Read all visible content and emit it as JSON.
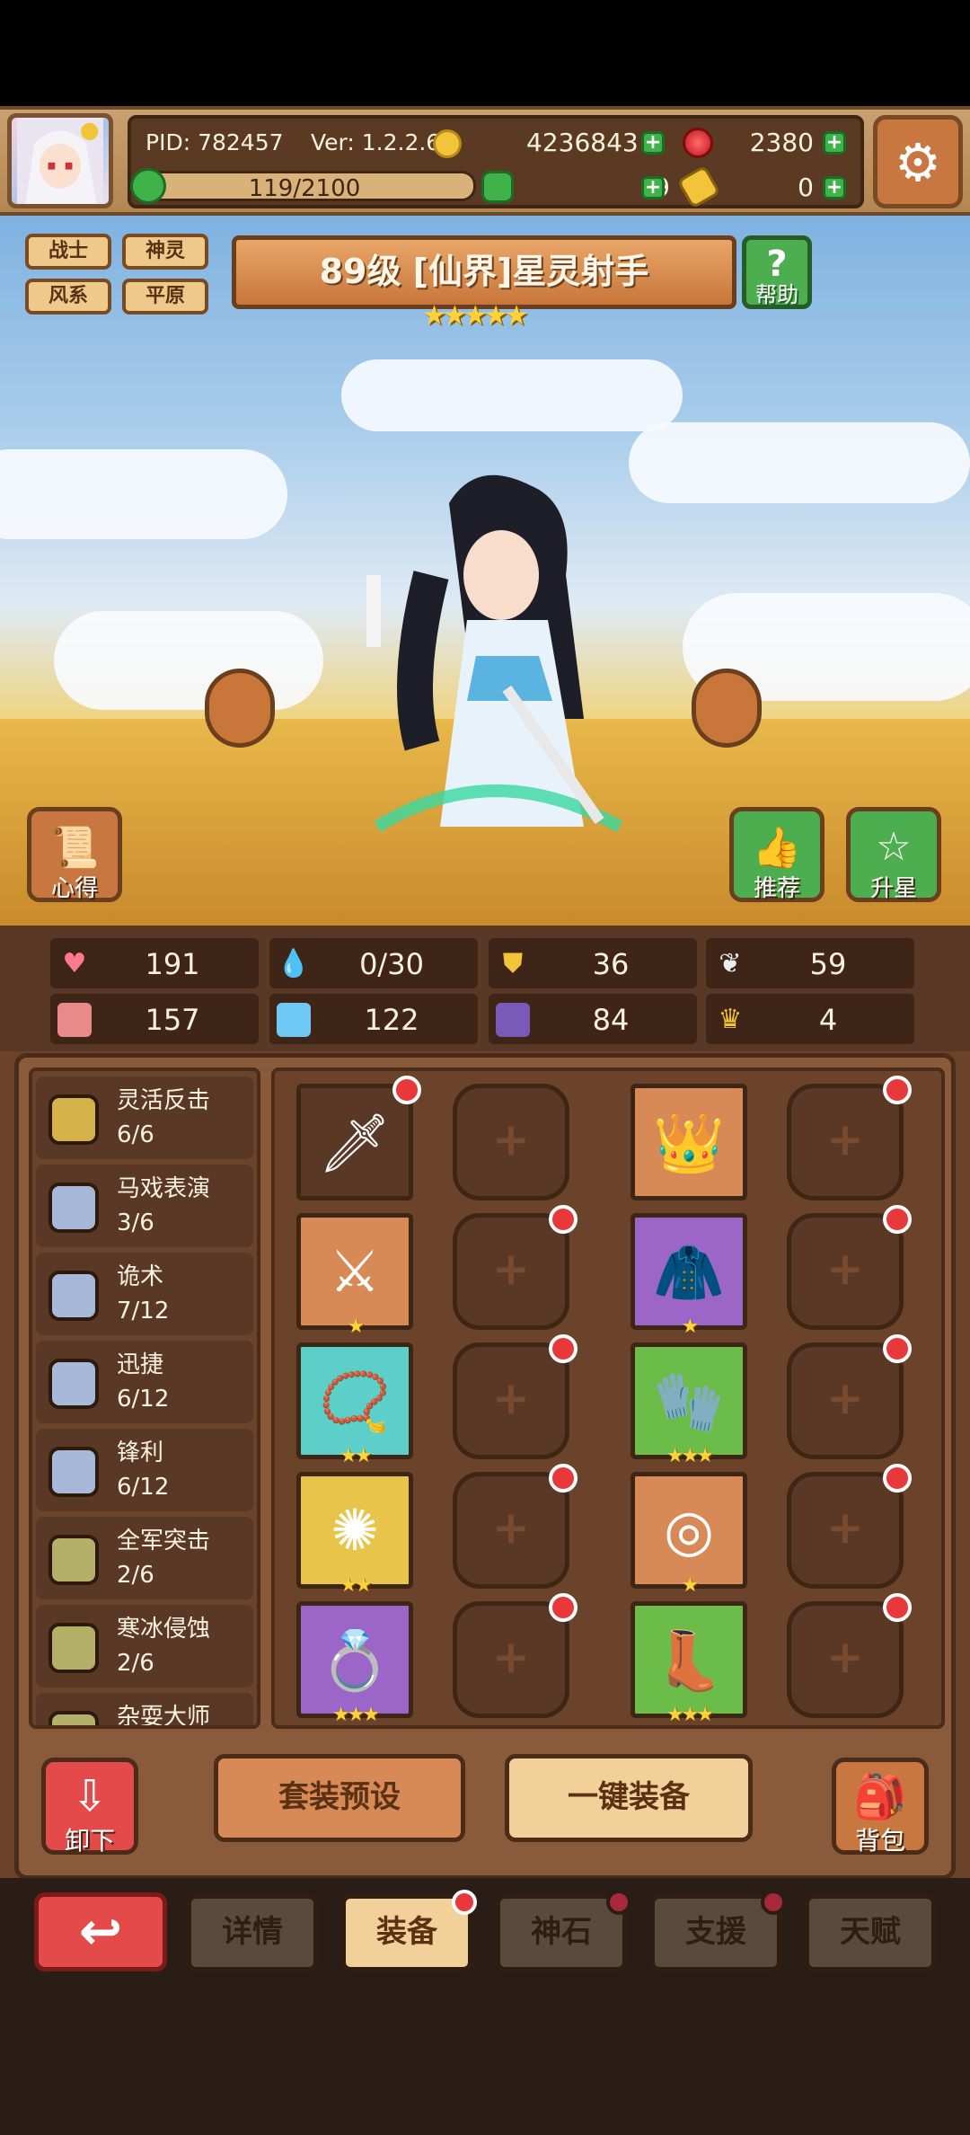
{
  "header": {
    "pid": "PID: 782457",
    "version": "Ver: 1.2.2.6",
    "gold": "4236843",
    "gems": "2380",
    "stamina": "119/2100",
    "clovers": "9",
    "keys": "0"
  },
  "hero": {
    "tags": [
      "战士",
      "神灵",
      "风系",
      "平原"
    ],
    "title": "89级 [仙界]星灵射手",
    "stars": "★★★★★",
    "help_label": "帮助"
  },
  "side_buttons": {
    "insight": "心得",
    "recommend": "推荐",
    "star_up": "升星"
  },
  "stats": [
    {
      "icon": "heart-icon",
      "value": "191"
    },
    {
      "icon": "water-drop-icon",
      "value": "0/30"
    },
    {
      "icon": "shield-icon",
      "value": "36"
    },
    {
      "icon": "wing-icon",
      "value": "59"
    },
    {
      "icon": "fist-icon",
      "value": "157"
    },
    {
      "icon": "book-icon",
      "value": "122"
    },
    {
      "icon": "boot-icon",
      "value": "84"
    },
    {
      "icon": "crown-icon",
      "value": "4"
    }
  ],
  "skills": [
    {
      "name": "灵活反击",
      "progress": "6/6",
      "color": "#d6b24a"
    },
    {
      "name": "马戏表演",
      "progress": "3/6",
      "color": "#a8b8d8"
    },
    {
      "name": "诡术",
      "progress": "7/12",
      "color": "#a8b8d8"
    },
    {
      "name": "迅捷",
      "progress": "6/12",
      "color": "#a8b8d8"
    },
    {
      "name": "锋利",
      "progress": "6/12",
      "color": "#a8b8d8"
    },
    {
      "name": "全军突击",
      "progress": "2/6",
      "color": "#b4b06a"
    },
    {
      "name": "寒冰侵蚀",
      "progress": "2/6",
      "color": "#b4b06a"
    },
    {
      "name": "杂耍大师",
      "progress": "",
      "color": "#b4b06a"
    }
  ],
  "equipment": [
    {
      "kind": "weapon-placeholder",
      "stars": "",
      "bg": "#5a3826"
    },
    {
      "kind": "empty"
    },
    {
      "kind": "crown-helmet",
      "stars": "",
      "bg": "#d88a56"
    },
    {
      "kind": "empty"
    },
    {
      "kind": "crossed-swords",
      "stars": "★",
      "bg": "#d88a56"
    },
    {
      "kind": "empty"
    },
    {
      "kind": "green-armor",
      "stars": "★",
      "bg": "#9b66c8"
    },
    {
      "kind": "empty"
    },
    {
      "kind": "necklace",
      "stars": "★★",
      "bg": "#5ccfc8"
    },
    {
      "kind": "empty"
    },
    {
      "kind": "bracer",
      "stars": "★★★",
      "bg": "#6cbc4a"
    },
    {
      "kind": "empty"
    },
    {
      "kind": "amulet",
      "stars": "★★",
      "bg": "#e8c44a"
    },
    {
      "kind": "empty"
    },
    {
      "kind": "belt",
      "stars": "★",
      "bg": "#d88a56"
    },
    {
      "kind": "empty"
    },
    {
      "kind": "ring",
      "stars": "★★★",
      "bg": "#9b66c8"
    },
    {
      "kind": "empty"
    },
    {
      "kind": "boots",
      "stars": "★★★",
      "bg": "#6cbc4a"
    },
    {
      "kind": "empty"
    }
  ],
  "actions": {
    "unequip": "卸下",
    "preset": "套装预设",
    "auto_equip": "一键装备",
    "bag": "背包"
  },
  "tabs": [
    "详情",
    "装备",
    "神石",
    "支援",
    "天赋"
  ]
}
